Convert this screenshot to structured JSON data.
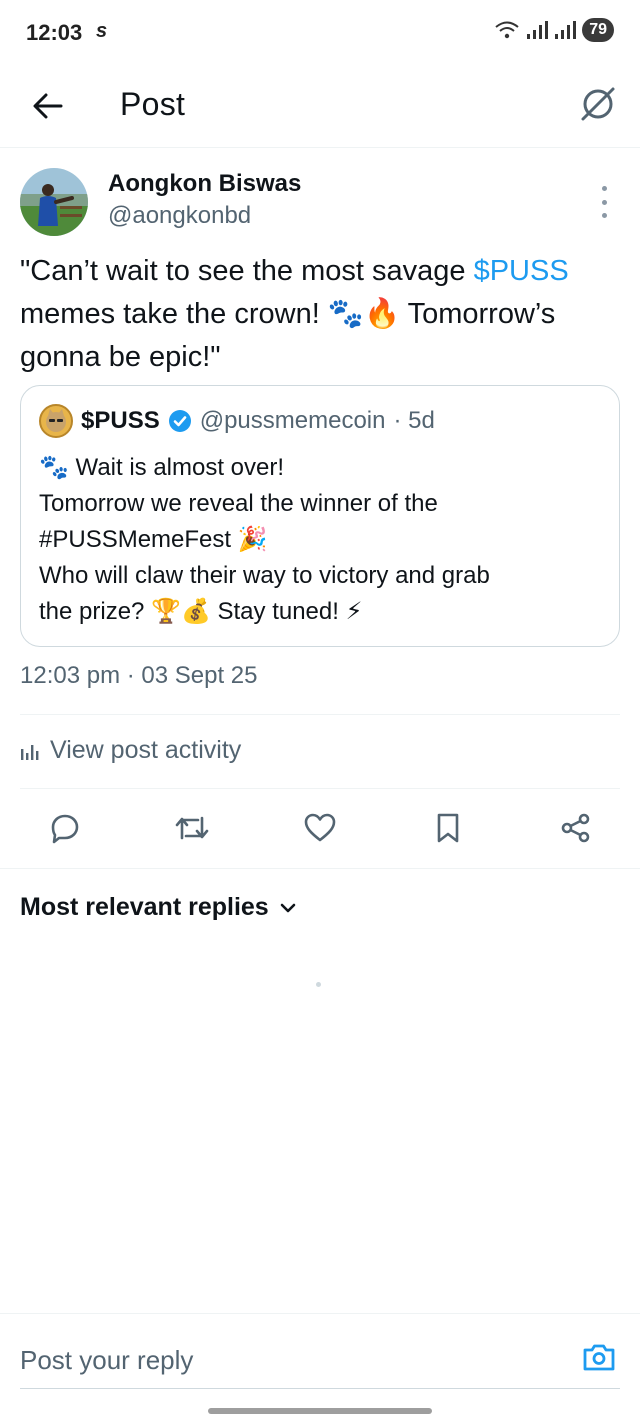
{
  "status_bar": {
    "time": "12:03",
    "carrier_icon": "s",
    "battery": "79"
  },
  "header": {
    "title": "Post",
    "back_icon": "arrow-left-icon",
    "grok_icon": "grok-icon"
  },
  "post": {
    "author_name": "Aongkon Biswas",
    "author_handle": "@aongkonbd",
    "text_before": "\"Can’t wait to see the most savage ",
    "cashtag": "$PUSS",
    "text_after": " memes take the crown! 🐾🔥 Tomorrow’s gonna be epic!\"",
    "timestamp": "12:03 pm · 03 Sept 25",
    "view_activity": "View post activity"
  },
  "quoted_post": {
    "author_name": "$PUSS",
    "verified": true,
    "handle": "@pussmemecoin",
    "age": "· 5d",
    "lines": [
      "🐾 Wait is almost over!",
      "Tomorrow we reveal the winner of the",
      "#PUSSMemeFest 🎉",
      "Who will claw their way to victory and grab",
      "the prize? 🏆💰 Stay tuned! ⚡"
    ]
  },
  "actions": [
    "reply-icon",
    "repost-icon",
    "like-icon",
    "bookmark-icon",
    "share-icon"
  ],
  "replies": {
    "sort_label": "Most relevant replies"
  },
  "reply_bar": {
    "placeholder": "Post your reply"
  },
  "colors": {
    "accent": "#1d9bf0",
    "text_primary": "#0f1419",
    "text_secondary": "#536471",
    "divider": "#eff3f4"
  }
}
